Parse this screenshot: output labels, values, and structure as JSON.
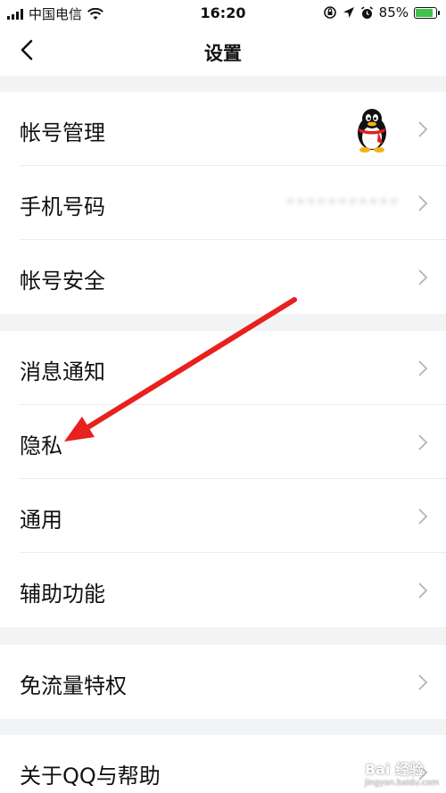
{
  "status_bar": {
    "carrier": "中国电信",
    "time": "16:20",
    "battery": "85%"
  },
  "nav": {
    "title": "设置"
  },
  "groups": [
    {
      "items": [
        {
          "label": "帐号管理"
        },
        {
          "label": "手机号码",
          "value": "•••••••••••"
        },
        {
          "label": "帐号安全"
        }
      ]
    },
    {
      "items": [
        {
          "label": "消息通知"
        },
        {
          "label": "隐私"
        },
        {
          "label": "通用"
        },
        {
          "label": "辅助功能"
        }
      ]
    },
    {
      "items": [
        {
          "label": "免流量特权"
        }
      ]
    },
    {
      "items": [
        {
          "label": "关于QQ与帮助"
        }
      ]
    }
  ],
  "watermark": {
    "text": "Bai 经验",
    "url": "jingyan.baidu.com"
  },
  "colors": {
    "background": "#f2f3f5",
    "annotation_arrow": "#e8201e",
    "battery_fill": "#3ec24b"
  }
}
